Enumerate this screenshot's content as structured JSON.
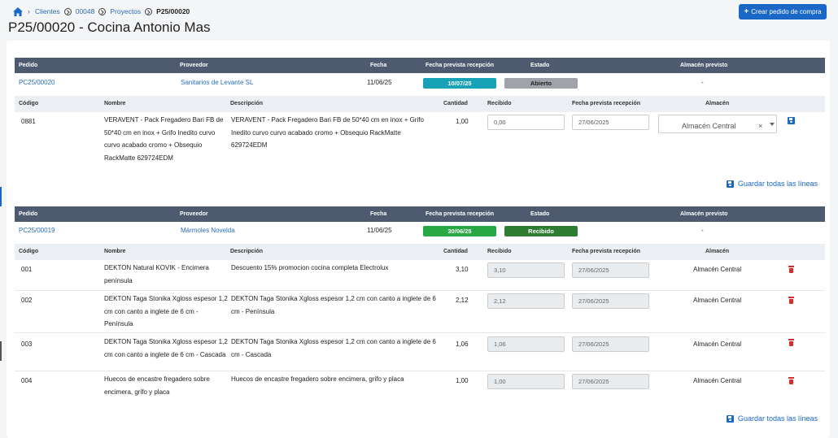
{
  "breadcrumb": {
    "clientes": "Clientes",
    "cliente_id": "00048",
    "proyectos": "Proyectos",
    "current": "P25/00020"
  },
  "page_title": "P25/00020 - Cocina Antonio Mas",
  "new_order_button": "Crear pedido de compra",
  "order_headers": {
    "pedido": "Pedido",
    "proveedor": "Proveedor",
    "fecha": "Fecha",
    "fecha_prevista": "Fecha prevista recepción",
    "estado": "Estado",
    "almacen": "Almacén previsto"
  },
  "line_headers": {
    "codigo": "Código",
    "nombre": "Nombre",
    "descripcion": "Descripción",
    "cantidad": "Cantidad",
    "recibido": "Recibido",
    "fecha_prevista": "Fecha prevista recepción",
    "almacen": "Almacén"
  },
  "save_all_label": "Guardar todas las líneas",
  "orders": [
    {
      "pedido": "PC25/00020",
      "proveedor": "Sanitarios de Levante SL",
      "fecha": "11/06/25",
      "fecha_prevista": "10/07/25",
      "estado": "Abierto",
      "almacen": "-",
      "lines": [
        {
          "codigo": "0881",
          "nombre": [
            "VERAVENT - Pack Fregadero Bari FB de",
            "50*40 cm en inox + Grifo Inedito curvo",
            "curvo acabado cromo + Obsequio",
            "RackMatte 629724EDM"
          ],
          "descripcion": [
            "VERAVENT - Pack Fregadero Bari FB de 50*40 cm en inox + Grifo",
            "Inedito curvo curvo acabado cromo + Obsequio RackMatte",
            "629724EDM"
          ],
          "cantidad": "1,00",
          "recibido": "0,00",
          "fecha": "27/06/2025",
          "almacen": "Almacén Central"
        }
      ]
    },
    {
      "pedido": "PC25/00019",
      "proveedor": "Mármoles Novelda",
      "fecha": "11/06/25",
      "fecha_prevista": "30/06/25",
      "estado": "Recibido",
      "almacen": "-",
      "lines": [
        {
          "codigo": "001",
          "nombre": [
            "DEKTON Natural KOVIK - Encimera",
            "península"
          ],
          "descripcion": [
            "Descuento 15% promocion cocina completa Electrolux"
          ],
          "cantidad": "3,10",
          "recibido": "3,10",
          "fecha": "27/06/2025",
          "almacen": "Almacén Central"
        },
        {
          "codigo": "002",
          "nombre": [
            "DEKTON Taga Stonika Xgloss espesor 1,2",
            "cm con canto a inglete de 6 cm -",
            "Península"
          ],
          "descripcion": [
            "DEKTON Taga Stonika Xgloss espesor 1,2 cm con canto a inglete de 6",
            "cm - Península"
          ],
          "cantidad": "2,12",
          "recibido": "2,12",
          "fecha": "27/06/2025",
          "almacen": "Almacén Central"
        },
        {
          "codigo": "003",
          "nombre": [
            "DEKTON Taga Stonika Xgloss espesor 1,2",
            "cm con canto a inglete de 6 cm - Cascada"
          ],
          "descripcion": [
            "DEKTON Taga Stonika Xgloss espesor 1,2 cm con canto a inglete de 6",
            "cm - Cascada"
          ],
          "cantidad": "1,06",
          "recibido": "1,06",
          "fecha": "27/06/2025",
          "almacen": "Almacén Central"
        },
        {
          "codigo": "004",
          "nombre": [
            "Huecos de encastre fregadero sobre",
            "encimera, grifo y placa"
          ],
          "descripcion": [
            "Huecos de encastre fregadero sobre encimera, grifo y placa"
          ],
          "cantidad": "1,00",
          "recibido": "1,00",
          "fecha": "27/06/2025",
          "almacen": "Almacén Central"
        }
      ]
    }
  ],
  "colors": {
    "primary": "#1967c7",
    "header_bg": "#4e5a70",
    "status_open": "#a0a4aa",
    "status_received": "#34a853",
    "date_badge_1": "#17a2b8",
    "date_badge_2": "#28a745",
    "delete": "#d32f2f"
  }
}
